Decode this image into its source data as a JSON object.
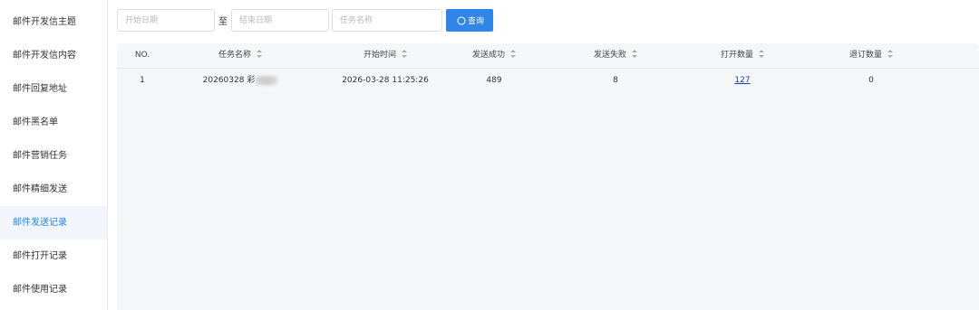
{
  "sidebar": {
    "items": [
      {
        "label": "邮件开发信主题"
      },
      {
        "label": "邮件开发信内容"
      },
      {
        "label": "邮件回复地址"
      },
      {
        "label": "邮件黑名单"
      },
      {
        "label": "邮件营销任务"
      },
      {
        "label": "邮件精细发送"
      },
      {
        "label": "邮件发送记录"
      },
      {
        "label": "邮件打开记录"
      },
      {
        "label": "邮件使用记录"
      }
    ],
    "active_index": 6
  },
  "filters": {
    "start_date_placeholder": "开始日期",
    "separator": "至",
    "end_date_placeholder": "结束日期",
    "task_name_placeholder": "任务名称",
    "search_label": "查询"
  },
  "table": {
    "columns": [
      {
        "label": "NO.",
        "sortable": false
      },
      {
        "label": "任务名称",
        "sortable": true
      },
      {
        "label": "开始时间",
        "sortable": true
      },
      {
        "label": "发送成功",
        "sortable": true
      },
      {
        "label": "发送失败",
        "sortable": true
      },
      {
        "label": "打开数量",
        "sortable": true
      },
      {
        "label": "退订数量",
        "sortable": true
      }
    ],
    "rows": [
      {
        "no": "1",
        "task_name": "20260328 彩",
        "start_time": "2026-03-28 11:25:26",
        "sent_success": "489",
        "sent_failed": "8",
        "opened": "127",
        "unsubscribed": "0"
      }
    ]
  },
  "colors": {
    "accent": "#2f86e8",
    "active_nav_text": "#1e88e5",
    "active_nav_bg": "#f2f6fc",
    "link": "#1a3fb8",
    "table_bg": "#f5f6f8"
  }
}
